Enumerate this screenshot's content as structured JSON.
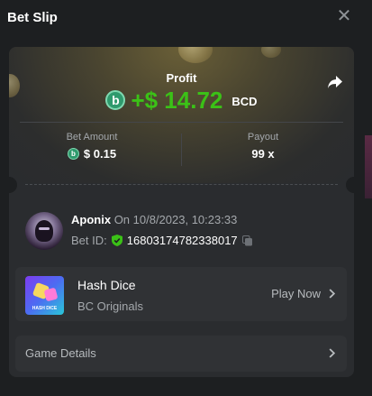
{
  "header": {
    "title": "Bet Slip",
    "close_icon": "close-icon"
  },
  "summary": {
    "profit_label": "Profit",
    "coin_symbol": "b",
    "profit_value": "+$ 14.72",
    "currency": "BCD",
    "bet_amount_label": "Bet Amount",
    "bet_amount_value": "$ 0.15",
    "payout_label": "Payout",
    "payout_value": "99 x"
  },
  "user": {
    "name": "Aponix",
    "date_text": "On 10/8/2023, 10:23:33",
    "bet_id_label": "Bet ID:",
    "bet_id": "168031747823380​17"
  },
  "game": {
    "thumb_text": "HASH DICE",
    "name": "Hash Dice",
    "provider": "BC Originals",
    "play_label": "Play Now"
  },
  "details": {
    "label": "Game Details"
  },
  "colors": {
    "profit_green": "#3bc117",
    "coin_green": "#2f9a6d",
    "background": "#1d1f21",
    "card": "#2a2c2f"
  }
}
